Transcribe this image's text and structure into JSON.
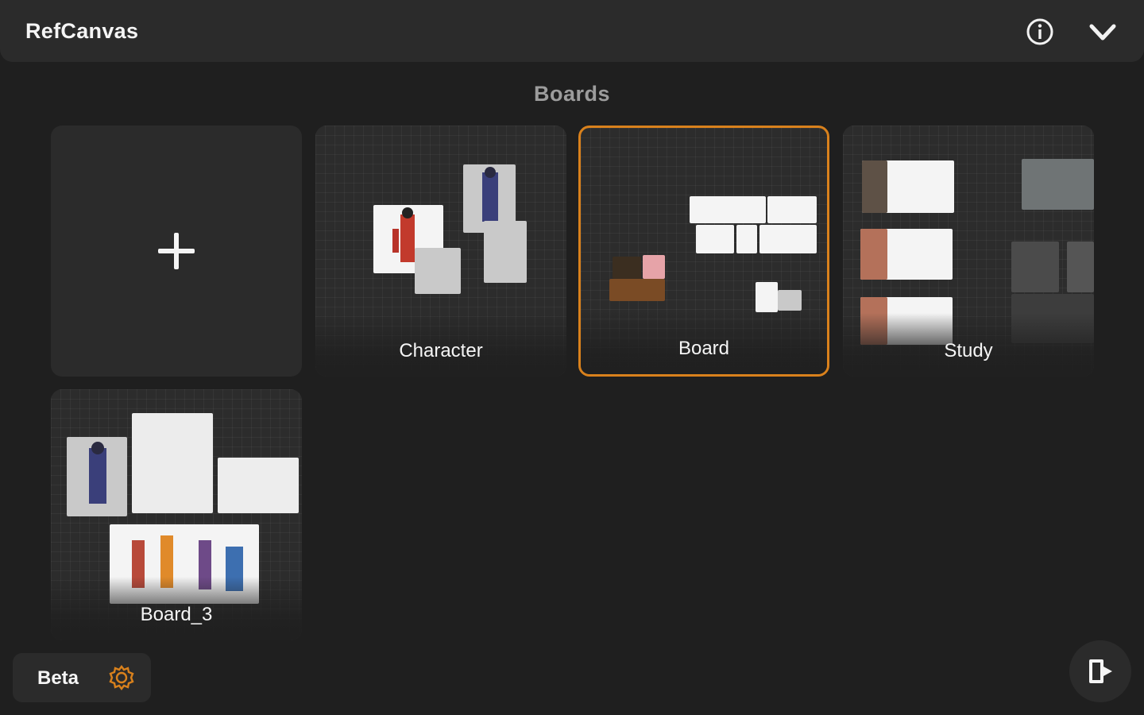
{
  "app": {
    "title": "RefCanvas"
  },
  "header": {
    "info_icon": "info-icon",
    "collapse_icon": "chevron-down-icon"
  },
  "boards_section": {
    "title": "Boards",
    "new_board_icon": "plus-icon",
    "boards": [
      {
        "label": "Character",
        "selected": false
      },
      {
        "label": "Board",
        "selected": true
      },
      {
        "label": "Study",
        "selected": false
      },
      {
        "label": "Board_3",
        "selected": false
      }
    ]
  },
  "footer": {
    "beta_label": "Beta",
    "beta_icon": "settings-gear-icon",
    "exit_icon": "exit-door-icon"
  },
  "colors": {
    "background": "#1f1f1f",
    "panel": "#2b2b2b",
    "accent": "#d9811c",
    "text": "#f5f5f5",
    "muted_text": "#9c9c9c"
  }
}
